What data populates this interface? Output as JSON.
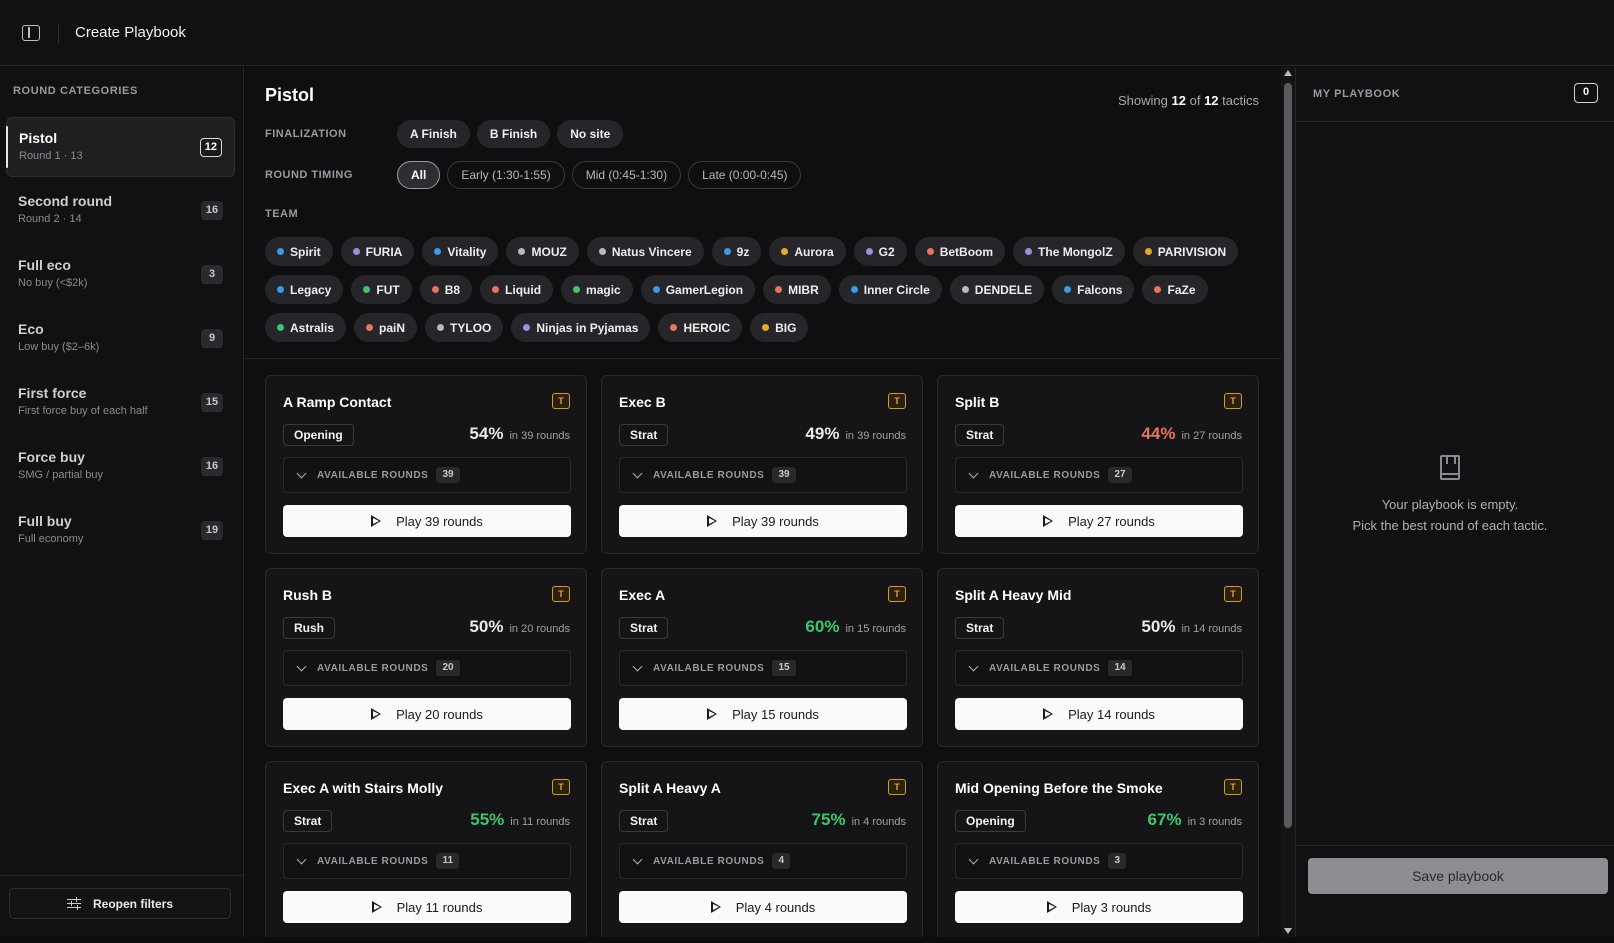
{
  "header": {
    "title": "Create Playbook"
  },
  "sidebar": {
    "heading": "ROUND CATEGORIES",
    "items": [
      {
        "name": "Pistol",
        "sub": "Round 1 · 13",
        "count": "12",
        "active": true
      },
      {
        "name": "Second round",
        "sub": "Round 2 · 14",
        "count": "16"
      },
      {
        "name": "Full eco",
        "sub": "No buy (<$2k)",
        "count": "3"
      },
      {
        "name": "Eco",
        "sub": "Low buy ($2–6k)",
        "count": "9"
      },
      {
        "name": "First force",
        "sub": "First force buy of each half",
        "count": "15"
      },
      {
        "name": "Force buy",
        "sub": "SMG / partial buy",
        "count": "16"
      },
      {
        "name": "Full buy",
        "sub": "Full economy",
        "count": "19"
      }
    ],
    "reopen_label": "Reopen filters"
  },
  "main": {
    "title": "Pistol",
    "showing": {
      "prefix": "Showing",
      "shown": "12",
      "of": "of",
      "total": "12",
      "suffix": "tactics"
    },
    "finalization": {
      "label": "FINALIZATION",
      "options": [
        "A Finish",
        "B Finish",
        "No site"
      ]
    },
    "timing": {
      "label": "ROUND TIMING",
      "options": [
        "All",
        "Early (1:30-1:55)",
        "Mid (0:45-1:30)",
        "Late (0:00-0:45)"
      ],
      "selected": "All"
    },
    "team": {
      "label": "TEAM",
      "teams": [
        {
          "name": "Spirit",
          "color": "#3b9be6"
        },
        {
          "name": "FURIA",
          "color": "#9b8fe0"
        },
        {
          "name": "Vitality",
          "color": "#3b9be6"
        },
        {
          "name": "MOUZ",
          "color": "#b8b8c0"
        },
        {
          "name": "Natus Vincere",
          "color": "#b8b8c0"
        },
        {
          "name": "9z",
          "color": "#3b9be6"
        },
        {
          "name": "Aurora",
          "color": "#e6a92a"
        },
        {
          "name": "G2",
          "color": "#9b8fe0"
        },
        {
          "name": "BetBoom",
          "color": "#e8735e"
        },
        {
          "name": "The MongolZ",
          "color": "#9b8fe0"
        },
        {
          "name": "PARIVISION",
          "color": "#e6a92a"
        },
        {
          "name": "Legacy",
          "color": "#3b9be6"
        },
        {
          "name": "FUT",
          "color": "#3ec46d"
        },
        {
          "name": "B8",
          "color": "#e8735e"
        },
        {
          "name": "Liquid",
          "color": "#e8735e"
        },
        {
          "name": "magic",
          "color": "#3ec46d"
        },
        {
          "name": "GamerLegion",
          "color": "#3b9be6"
        },
        {
          "name": "MIBR",
          "color": "#e8735e"
        },
        {
          "name": "Inner Circle",
          "color": "#3b9be6"
        },
        {
          "name": "DENDELE",
          "color": "#b8b8c0"
        },
        {
          "name": "Falcons",
          "color": "#3b9be6"
        },
        {
          "name": "FaZe",
          "color": "#e8735e"
        },
        {
          "name": "Astralis",
          "color": "#3ec46d"
        },
        {
          "name": "paiN",
          "color": "#e8735e"
        },
        {
          "name": "TYLOO",
          "color": "#b8b8c0"
        },
        {
          "name": "Ninjas in Pyjamas",
          "color": "#9b8fe0"
        },
        {
          "name": "HEROIC",
          "color": "#e8735e"
        },
        {
          "name": "BIG",
          "color": "#e6a92a"
        }
      ]
    },
    "available_label": "AVAILABLE ROUNDS",
    "side_badge": "T",
    "tactics": [
      {
        "title": "A Ramp Contact",
        "type": "Opening",
        "pct": "54%",
        "rounds_text": "in 39 rounds",
        "available": "39",
        "play": "Play 39 rounds",
        "color": "#e8e8ea"
      },
      {
        "title": "Exec B",
        "type": "Strat",
        "pct": "49%",
        "rounds_text": "in 39 rounds",
        "available": "39",
        "play": "Play 39 rounds",
        "color": "#e8e8ea"
      },
      {
        "title": "Split B",
        "type": "Strat",
        "pct": "44%",
        "rounds_text": "in 27 rounds",
        "available": "27",
        "play": "Play 27 rounds",
        "color": "#e8735e"
      },
      {
        "title": "Rush B",
        "type": "Rush",
        "pct": "50%",
        "rounds_text": "in 20 rounds",
        "available": "20",
        "play": "Play 20 rounds",
        "color": "#e8e8ea"
      },
      {
        "title": "Exec A",
        "type": "Strat",
        "pct": "60%",
        "rounds_text": "in 15 rounds",
        "available": "15",
        "play": "Play 15 rounds",
        "color": "#3ec46d"
      },
      {
        "title": "Split A Heavy Mid",
        "type": "Strat",
        "pct": "50%",
        "rounds_text": "in 14 rounds",
        "available": "14",
        "play": "Play 14 rounds",
        "color": "#e8e8ea"
      },
      {
        "title": "Exec A with Stairs Molly",
        "type": "Strat",
        "pct": "55%",
        "rounds_text": "in 11 rounds",
        "available": "11",
        "play": "Play 11 rounds",
        "color": "#3ec46d"
      },
      {
        "title": "Split A Heavy A",
        "type": "Strat",
        "pct": "75%",
        "rounds_text": "in 4 rounds",
        "available": "4",
        "play": "Play 4 rounds",
        "color": "#3ec46d"
      },
      {
        "title": "Mid Opening Before the Smoke",
        "type": "Opening",
        "pct": "67%",
        "rounds_text": "in 3 rounds",
        "available": "3",
        "play": "Play 3 rounds",
        "color": "#3ec46d"
      }
    ]
  },
  "playbook": {
    "label": "MY PLAYBOOK",
    "count": "0",
    "empty_line1": "Your playbook is empty.",
    "empty_line2": "Pick the best round of each tactic.",
    "save_label": "Save playbook"
  }
}
